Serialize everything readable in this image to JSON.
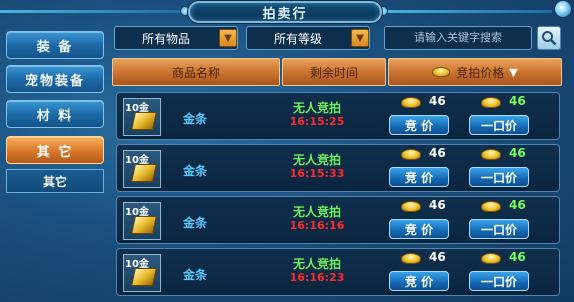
{
  "window": {
    "title": "拍卖行"
  },
  "sidebar": {
    "items": [
      {
        "label": "装 备",
        "active": false
      },
      {
        "label": "宠物装备",
        "active": false
      },
      {
        "label": "材 料",
        "active": false
      },
      {
        "label": "其 它",
        "active": true
      }
    ],
    "sub_item": "其它"
  },
  "filters": {
    "category": "所有物品",
    "level": "所有等级",
    "search_placeholder": "请输入关键字搜索"
  },
  "table": {
    "headers": [
      "商品名称",
      "剩余时间",
      "竞拍价格"
    ],
    "rows": [
      {
        "qty": "10金",
        "name": "金条",
        "status": "无人竞拍",
        "time": "16:15:25",
        "bid_price": "46",
        "buy_price": "46",
        "bid_label": "竞 价",
        "buy_label": "一口价"
      },
      {
        "qty": "10金",
        "name": "金条",
        "status": "无人竞拍",
        "time": "16:15:33",
        "bid_price": "46",
        "buy_price": "46",
        "bid_label": "竞 价",
        "buy_label": "一口价"
      },
      {
        "qty": "10金",
        "name": "金条",
        "status": "无人竞拍",
        "time": "16:16:16",
        "bid_price": "46",
        "buy_price": "46",
        "bid_label": "竞 价",
        "buy_label": "一口价"
      },
      {
        "qty": "10金",
        "name": "金条",
        "status": "无人竞拍",
        "time": "16:16:23",
        "bid_price": "46",
        "buy_price": "46",
        "bid_label": "竞 价",
        "buy_label": "一口价"
      }
    ]
  },
  "colors": {
    "accent_orange": "#d8782a",
    "time_red": "#ff2a2a",
    "status_green": "#6df05b",
    "item_blue": "#54c8ff"
  }
}
